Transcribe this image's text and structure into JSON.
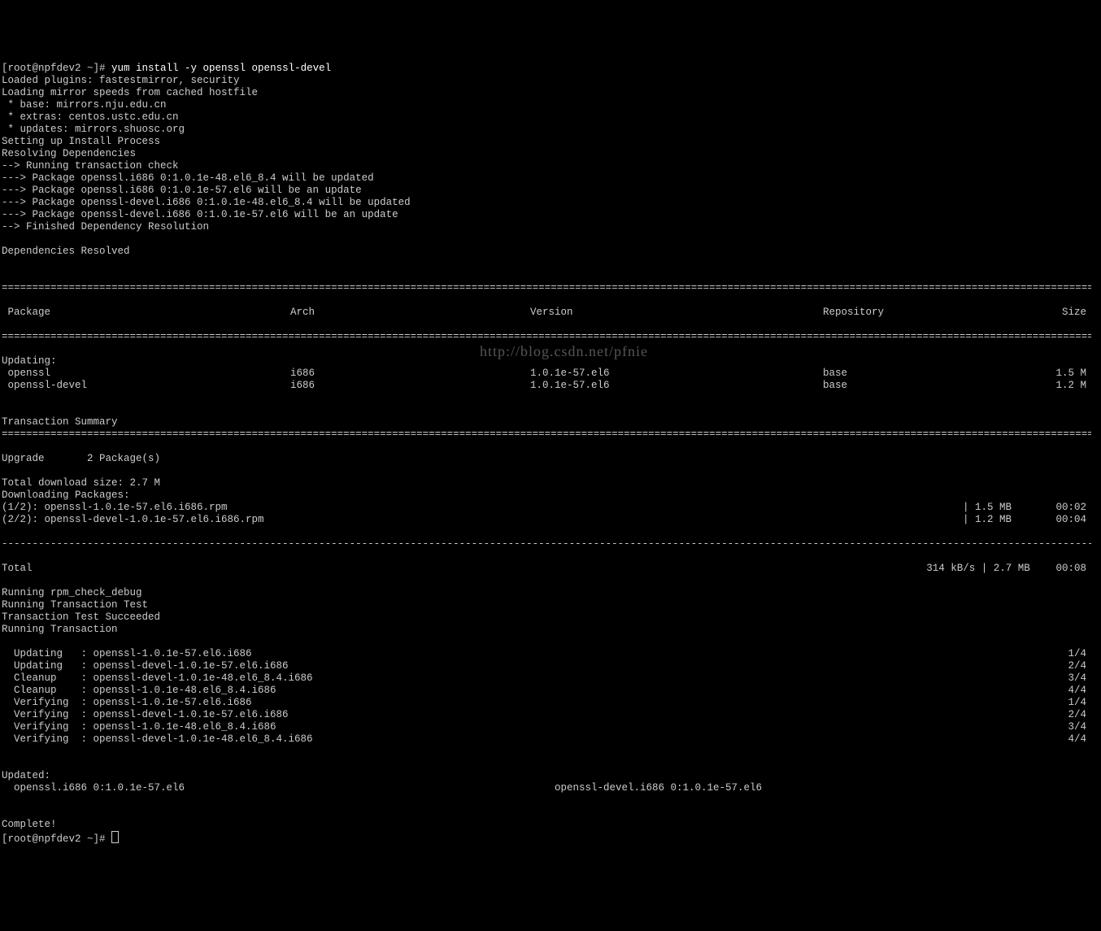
{
  "prompt1": "[root@npfdev2 ~]# ",
  "cmd1": "yum install -y openssl openssl-devel",
  "lines_pre": [
    "Loaded plugins: fastestmirror, security",
    "Loading mirror speeds from cached hostfile",
    " * base: mirrors.nju.edu.cn",
    " * extras: centos.ustc.edu.cn",
    " * updates: mirrors.shuosc.org",
    "Setting up Install Process",
    "Resolving Dependencies",
    "--> Running transaction check",
    "---> Package openssl.i686 0:1.0.1e-48.el6_8.4 will be updated",
    "---> Package openssl.i686 0:1.0.1e-57.el6 will be an update",
    "---> Package openssl-devel.i686 0:1.0.1e-48.el6_8.4 will be updated",
    "---> Package openssl-devel.i686 0:1.0.1e-57.el6 will be an update",
    "--> Finished Dependency Resolution",
    "",
    "Dependencies Resolved",
    ""
  ],
  "hdr": {
    "pkg": " Package",
    "arch": "Arch",
    "ver": "Version",
    "repo": "Repository",
    "size": "Size"
  },
  "updating_label": "Updating:",
  "rows": [
    {
      "pkg": " openssl",
      "arch": "i686",
      "ver": "1.0.1e-57.el6",
      "repo": "base",
      "size": "1.5 M"
    },
    {
      "pkg": " openssl-devel",
      "arch": "i686",
      "ver": "1.0.1e-57.el6",
      "repo": "base",
      "size": "1.2 M"
    }
  ],
  "trans_summary": "Transaction Summary",
  "upgrade_line": "Upgrade       2 Package(s)",
  "dl_size": "Total download size: 2.7 M",
  "dl_pkgs": "Downloading Packages:",
  "dls": [
    {
      "name": "(1/2): openssl-1.0.1e-57.el6.i686.rpm",
      "size": "| 1.5 MB",
      "time": "00:02"
    },
    {
      "name": "(2/2): openssl-devel-1.0.1e-57.el6.i686.rpm",
      "size": "| 1.2 MB",
      "time": "00:04"
    }
  ],
  "total_row": {
    "name": "Total",
    "rate": "314 kB/s | 2.7 MB",
    "time": "00:08"
  },
  "post_lines": [
    "Running rpm_check_debug",
    "Running Transaction Test",
    "Transaction Test Succeeded",
    "Running Transaction"
  ],
  "trans": [
    {
      "l": "  Updating   : openssl-1.0.1e-57.el6.i686",
      "r": "1/4"
    },
    {
      "l": "  Updating   : openssl-devel-1.0.1e-57.el6.i686",
      "r": "2/4"
    },
    {
      "l": "  Cleanup    : openssl-devel-1.0.1e-48.el6_8.4.i686",
      "r": "3/4"
    },
    {
      "l": "  Cleanup    : openssl-1.0.1e-48.el6_8.4.i686",
      "r": "4/4"
    },
    {
      "l": "  Verifying  : openssl-1.0.1e-57.el6.i686",
      "r": "1/4"
    },
    {
      "l": "  Verifying  : openssl-devel-1.0.1e-57.el6.i686",
      "r": "2/4"
    },
    {
      "l": "  Verifying  : openssl-1.0.1e-48.el6_8.4.i686",
      "r": "3/4"
    },
    {
      "l": "  Verifying  : openssl-devel-1.0.1e-48.el6_8.4.i686",
      "r": "4/4"
    }
  ],
  "updated_label": "Updated:",
  "updated": [
    "  openssl.i686 0:1.0.1e-57.el6",
    "openssl-devel.i686 0:1.0.1e-57.el6"
  ],
  "complete": "Complete!",
  "prompt2": "[root@npfdev2 ~]# ",
  "watermark": "http://blog.csdn.net/pfnie",
  "eq": "============================================================================================================================================================================================",
  "dash": "--------------------------------------------------------------------------------------------------------------------------------------------------------------------------------------------"
}
